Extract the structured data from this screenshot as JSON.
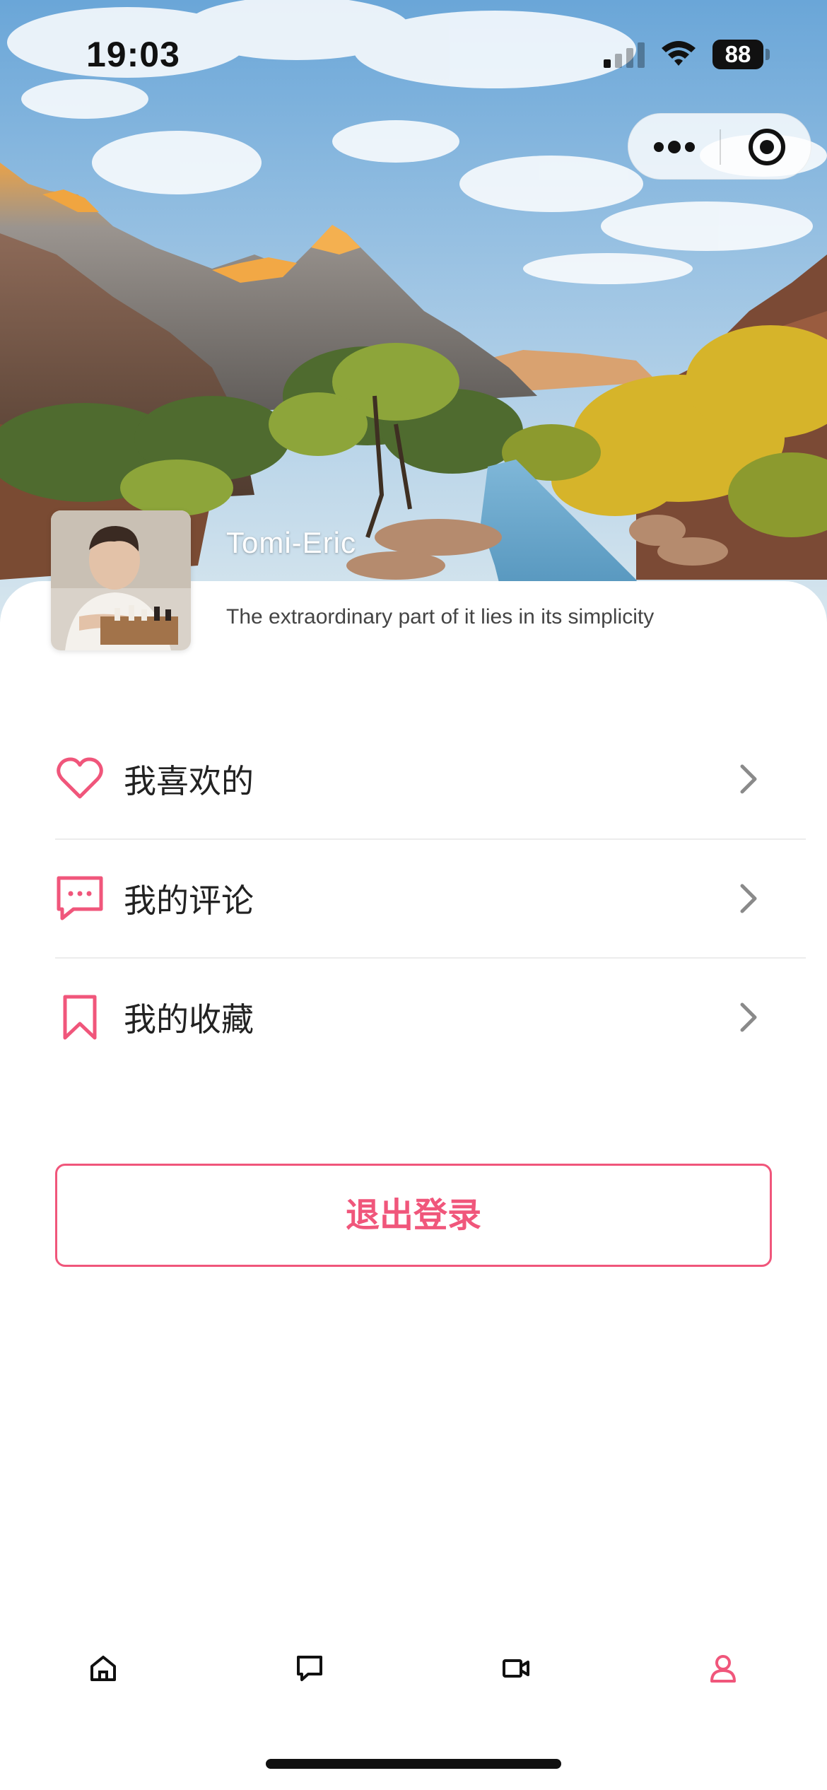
{
  "status_bar": {
    "time": "19:03",
    "battery": "88",
    "icons": [
      "signal-icon",
      "wifi-icon",
      "battery-icon"
    ]
  },
  "capsule": {
    "icons": [
      "more-icon",
      "close-target-icon"
    ]
  },
  "profile": {
    "username": "Tomi-Eric",
    "bio": "The extraordinary part of it lies in its simplicity"
  },
  "menu": {
    "items": [
      {
        "label": "我喜欢的",
        "icon": "heart-icon"
      },
      {
        "label": "我的评论",
        "icon": "comment-icon"
      },
      {
        "label": "我的收藏",
        "icon": "bookmark-icon"
      }
    ]
  },
  "logout": {
    "label": "退出登录"
  },
  "tabbar": {
    "tabs": [
      {
        "icon": "home-icon",
        "active": false
      },
      {
        "icon": "message-icon",
        "active": false
      },
      {
        "icon": "video-icon",
        "active": false
      },
      {
        "icon": "user-icon",
        "active": true
      }
    ]
  },
  "colors": {
    "accent": "#f0567b",
    "text": "#222222",
    "divider": "#ececec",
    "chevron": "#8a8a8a"
  }
}
